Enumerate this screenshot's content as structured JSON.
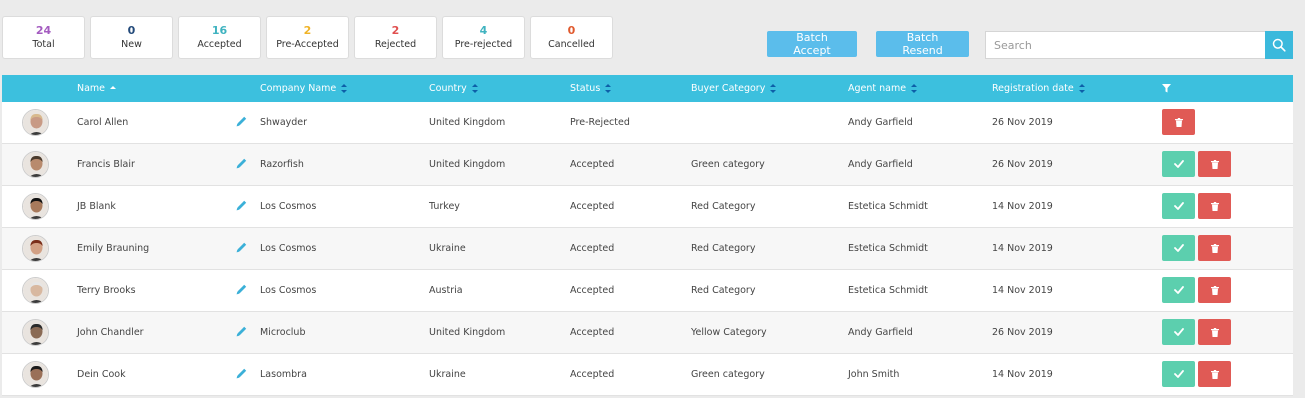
{
  "stats": [
    {
      "count": "24",
      "label": "Total",
      "color": "#a45cc0"
    },
    {
      "count": "0",
      "label": "New",
      "color": "#234a7a"
    },
    {
      "count": "16",
      "label": "Accepted",
      "color": "#3fb3c0"
    },
    {
      "count": "2",
      "label": "Pre-Accepted",
      "color": "#f0b429"
    },
    {
      "count": "2",
      "label": "Rejected",
      "color": "#e05050"
    },
    {
      "count": "4",
      "label": "Pre-rejected",
      "color": "#3fb3c0"
    },
    {
      "count": "0",
      "label": "Cancelled",
      "color": "#e05a2e"
    }
  ],
  "toolbar": {
    "batch_accept": "Batch Accept",
    "batch_resend": "Batch Resend",
    "search_placeholder": "Search",
    "search_value": ""
  },
  "table": {
    "headers": {
      "name": "Name",
      "company": "Company Name",
      "country": "Country",
      "status": "Status",
      "buyer_category": "Buyer Category",
      "agent": "Agent name",
      "registration": "Registration date"
    },
    "rows": [
      {
        "name": "Carol Allen",
        "company": "Shwayder",
        "country": "United Kingdom",
        "status": "Pre-Rejected",
        "buyer_category": "",
        "agent": "Andy Garfield",
        "date": "26 Nov 2019",
        "can_accept": false,
        "avatar_color": "#c89a85",
        "hair_color": "#d8b98d"
      },
      {
        "name": "Francis Blair",
        "company": "Razorfish",
        "country": "United Kingdom",
        "status": "Accepted",
        "buyer_category": "Green category",
        "agent": "Andy Garfield",
        "date": "26 Nov 2019",
        "can_accept": true,
        "avatar_color": "#b88a6d",
        "hair_color": "#4a3a2c"
      },
      {
        "name": "JB Blank",
        "company": "Los Cosmos",
        "country": "Turkey",
        "status": "Accepted",
        "buyer_category": "Red Category",
        "agent": "Estetica Schmidt",
        "date": "14 Nov 2019",
        "can_accept": true,
        "avatar_color": "#a87a5c",
        "hair_color": "#111111"
      },
      {
        "name": "Emily Brauning",
        "company": "Los Cosmos",
        "country": "Ukraine",
        "status": "Accepted",
        "buyer_category": "Red Category",
        "agent": "Estetica Schmidt",
        "date": "14 Nov 2019",
        "can_accept": true,
        "avatar_color": "#d2a084",
        "hair_color": "#7a2e1a"
      },
      {
        "name": "Terry Brooks",
        "company": "Los Cosmos",
        "country": "Austria",
        "status": "Accepted",
        "buyer_category": "Red Category",
        "agent": "Estetica Schmidt",
        "date": "14 Nov 2019",
        "can_accept": true,
        "avatar_color": "#d8b8a0",
        "hair_color": "#e6e6e6"
      },
      {
        "name": "John Chandler",
        "company": "Microclub",
        "country": "United Kingdom",
        "status": "Accepted",
        "buyer_category": "Yellow Category",
        "agent": "Andy Garfield",
        "date": "26 Nov 2019",
        "can_accept": true,
        "avatar_color": "#8a6a54",
        "hair_color": "#2a2a2a"
      },
      {
        "name": "Dein Cook",
        "company": "Lasombra",
        "country": "Ukraine",
        "status": "Accepted",
        "buyer_category": "Green category",
        "agent": "John Smith",
        "date": "14 Nov 2019",
        "can_accept": true,
        "avatar_color": "#9a7058",
        "hair_color": "#1a1a1a"
      }
    ]
  }
}
